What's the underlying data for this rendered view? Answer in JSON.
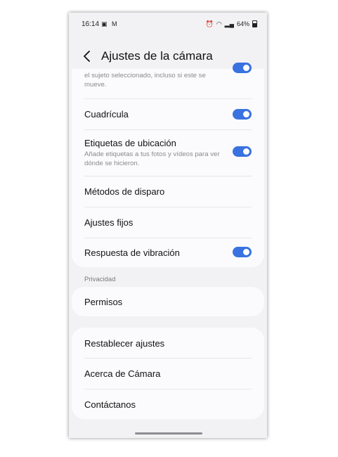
{
  "status_bar": {
    "time": "16:14",
    "left_icons": "▣ M",
    "battery_percent": "64%"
  },
  "header": {
    "title": "Ajustes de la cámara"
  },
  "settings_card": {
    "partial_desc": "el sujeto seleccionado, incluso si este se mueve.",
    "grid_label": "Cuadrícula",
    "grid_on": true,
    "location_label": "Etiquetas de ubicación",
    "location_desc": "Añade etiquetas a tus fotos y vídeos para ver dónde se hicieron.",
    "location_on": true,
    "shooting_methods_label": "Métodos de disparo",
    "fixed_settings_label": "Ajustes fijos",
    "vibration_label": "Respuesta de vibración",
    "vibration_on": true
  },
  "privacy": {
    "section_label": "Privacidad",
    "permissions_label": "Permisos"
  },
  "misc_card": {
    "reset_label": "Restablecer ajustes",
    "about_label": "Acerca de Cámara",
    "contact_label": "Contáctanos"
  },
  "colors": {
    "accent": "#3a72e0",
    "background": "#f2f2f4",
    "card": "#fbfbfd"
  }
}
